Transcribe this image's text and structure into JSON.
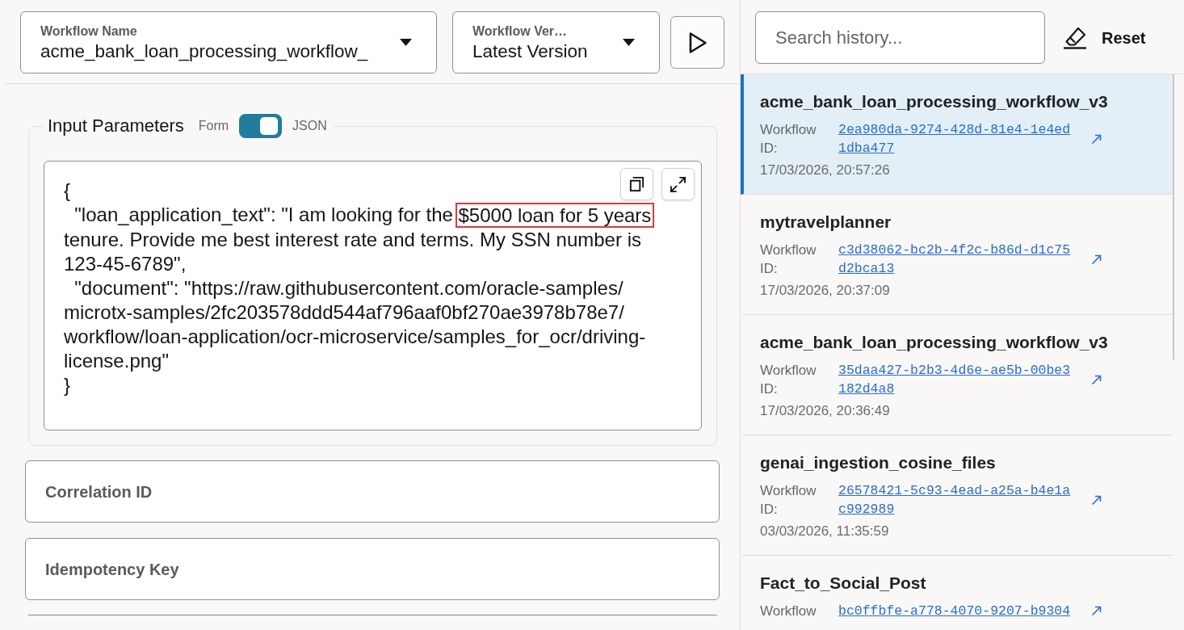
{
  "workflow_select": {
    "label": "Workflow Name",
    "value": "acme_bank_loan_processing_workflow_"
  },
  "version_select": {
    "label": "Workflow Ver…",
    "value": "Latest Version"
  },
  "input_parameters": {
    "title": "Input Parameters",
    "mode_left": "Form",
    "mode_right": "JSON",
    "json_mode_on": true,
    "editor": {
      "lines": [
        [
          {
            "text": "{",
            "highlighted": false
          }
        ],
        [
          {
            "text": "  \"loan_application_text\": \"I am looking for the ",
            "highlighted": false
          },
          {
            "text": "$5000 loan for 5 years",
            "highlighted": true
          }
        ],
        [
          {
            "text": "tenure. Provide me best interest rate and terms. My SSN number is",
            "highlighted": false
          }
        ],
        [
          {
            "text": "123-45-6789\",",
            "highlighted": false
          }
        ],
        [
          {
            "text": "  \"document\": \"https://raw.githubusercontent.com/oracle-samples/",
            "highlighted": false
          }
        ],
        [
          {
            "text": "microtx-samples/2fc203578ddd544af796aaf0bf270ae3978b78e7/",
            "highlighted": false
          }
        ],
        [
          {
            "text": "workflow/loan-application/ocr-microservice/samples_for_ocr/driving-",
            "highlighted": false
          }
        ],
        [
          {
            "text": "license.png\"",
            "highlighted": false
          }
        ],
        [
          {
            "text": "}",
            "highlighted": false
          }
        ]
      ]
    }
  },
  "fields": [
    {
      "placeholder": "Correlation ID"
    },
    {
      "placeholder": "Idempotency Key"
    }
  ],
  "history": {
    "search": {
      "placeholder": "Search history..."
    },
    "reset_label": "Reset",
    "items": [
      {
        "title": "acme_bank_loan_processing_workflow_v3",
        "id_label": "Workflow ID:",
        "workflow_id": "2ea980da-9274-428d-81e4-1e4ed1dba477",
        "timestamp": "17/03/2026, 20:57:26",
        "selected": true
      },
      {
        "title": "mytravelplanner",
        "id_label": "Workflow ID:",
        "workflow_id": "c3d38062-bc2b-4f2c-b86d-d1c75d2bca13",
        "timestamp": "17/03/2026, 20:37:09",
        "selected": false
      },
      {
        "title": "acme_bank_loan_processing_workflow_v3",
        "id_label": "Workflow ID:",
        "workflow_id": "35daa427-b2b3-4d6e-ae5b-00be3182d4a8",
        "timestamp": "17/03/2026, 20:36:49",
        "selected": false
      },
      {
        "title": "genai_ingestion_cosine_files",
        "id_label": "Workflow ID:",
        "workflow_id": "26578421-5c93-4ead-a25a-b4e1ac992989",
        "timestamp": "03/03/2026, 11:35:59",
        "selected": false
      },
      {
        "title": "Fact_to_Social_Post",
        "id_label": "Workflow",
        "workflow_id": "bc0ffbfe-a778-4070-9207-b9304",
        "selected": false
      }
    ]
  }
}
